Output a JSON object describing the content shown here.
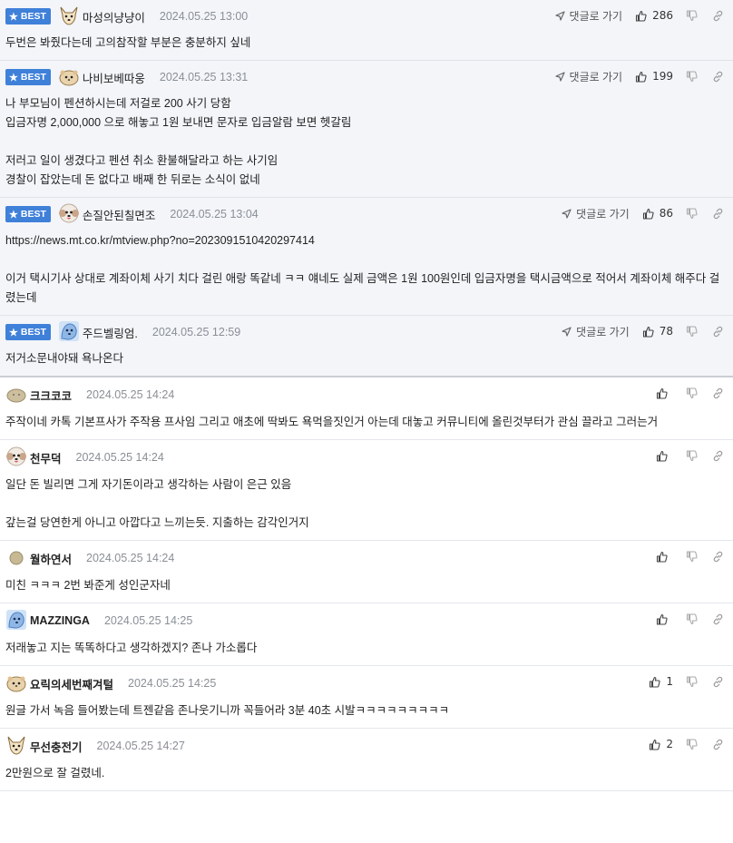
{
  "ui": {
    "reply_label": "댓글로 가기",
    "best_label": "BEST"
  },
  "comments": [
    {
      "best": true,
      "nickname": "마성의냥냥이",
      "avatar": "dog-white-icon",
      "date": "2024.05.25 13:00",
      "likes": "286",
      "text": "두번은 봐줬다는데 고의참작할 부분은 충분하지 싶네"
    },
    {
      "best": true,
      "nickname": "나비보베따웅",
      "avatar": "hamster-icon",
      "date": "2024.05.25 13:31",
      "likes": "199",
      "text": "나 부모님이 펜션하시는데 저걸로 200 사기 당함\n입금자명 2,000,000 으로 해놓고 1원 보내면 문자로 입금알람 보면 헷갈림\n\n저러고 일이 생겼다고 펜션 취소 환불해달라고 하는 사기임\n경찰이 잡았는데 돈 없다고 배째 한 뒤로는 소식이 없네"
    },
    {
      "best": true,
      "nickname": "손질안된칠면조",
      "avatar": "poodle-icon",
      "date": "2024.05.25 13:04",
      "likes": "86",
      "text": "https://news.mt.co.kr/mtview.php?no=2023091510420297414\n\n이거 택시기사 상대로 계좌이체 사기 치다 걸린 애랑 똑같네 ㅋㅋ 얘네도 실제 금액은 1원 100원인데 입금자명을 택시금액으로 적어서 계좌이체 해주다 걸렸는데"
    },
    {
      "best": true,
      "nickname": "주드벨링엄.",
      "avatar": "blue-dog-icon",
      "date": "2024.05.25 12:59",
      "likes": "78",
      "text": "저거소문내야돼 욕나온다"
    },
    {
      "best": false,
      "nickname": "크크코코",
      "avatar": "potato-icon",
      "date": "2024.05.25 14:24",
      "likes": "",
      "text": "주작이네 카톡 기본프사가 주작용 프사임 그리고 애초에 딱봐도 욕먹을짓인거 아는데 대놓고 커뮤니티에 올린것부터가 관심 끌라고 그러는거"
    },
    {
      "best": false,
      "nickname": "천무덕",
      "avatar": "poodle-icon",
      "date": "2024.05.25 14:24",
      "likes": "",
      "text": "일단 돈 빌리면 그게 자기돈이라고 생각하는 사람이 은근 있음\n\n갚는걸 당연한게 아니고 아깝다고 느끼는듯. 지출하는 감각인거지"
    },
    {
      "best": false,
      "nickname": "월하연서",
      "avatar": "potato-small-icon",
      "date": "2024.05.25 14:24",
      "likes": "",
      "text": "미친 ㅋㅋㅋ 2번 봐준게 성인군자네"
    },
    {
      "best": false,
      "nickname": "MAZZINGA",
      "avatar": "blue-dog-icon",
      "date": "2024.05.25 14:25",
      "likes": "",
      "text": "저래놓고 지는 똑똑하다고 생각하겠지? 존나 가소롭다"
    },
    {
      "best": false,
      "nickname": "요릭의세번째겨털",
      "avatar": "hamster-icon",
      "date": "2024.05.25 14:25",
      "likes": "1",
      "text": "원글 가서 녹음 들어봤는데 트젠같음 존나웃기니까 꼭들어라 3분 40초 시발ㅋㅋㅋㅋㅋㅋㅋㅋㅋ"
    },
    {
      "best": false,
      "nickname": "무선충전기",
      "avatar": "dog-white-icon",
      "date": "2024.05.25 14:27",
      "likes": "2",
      "text": "2만원으로 잘 걸렸네."
    }
  ]
}
